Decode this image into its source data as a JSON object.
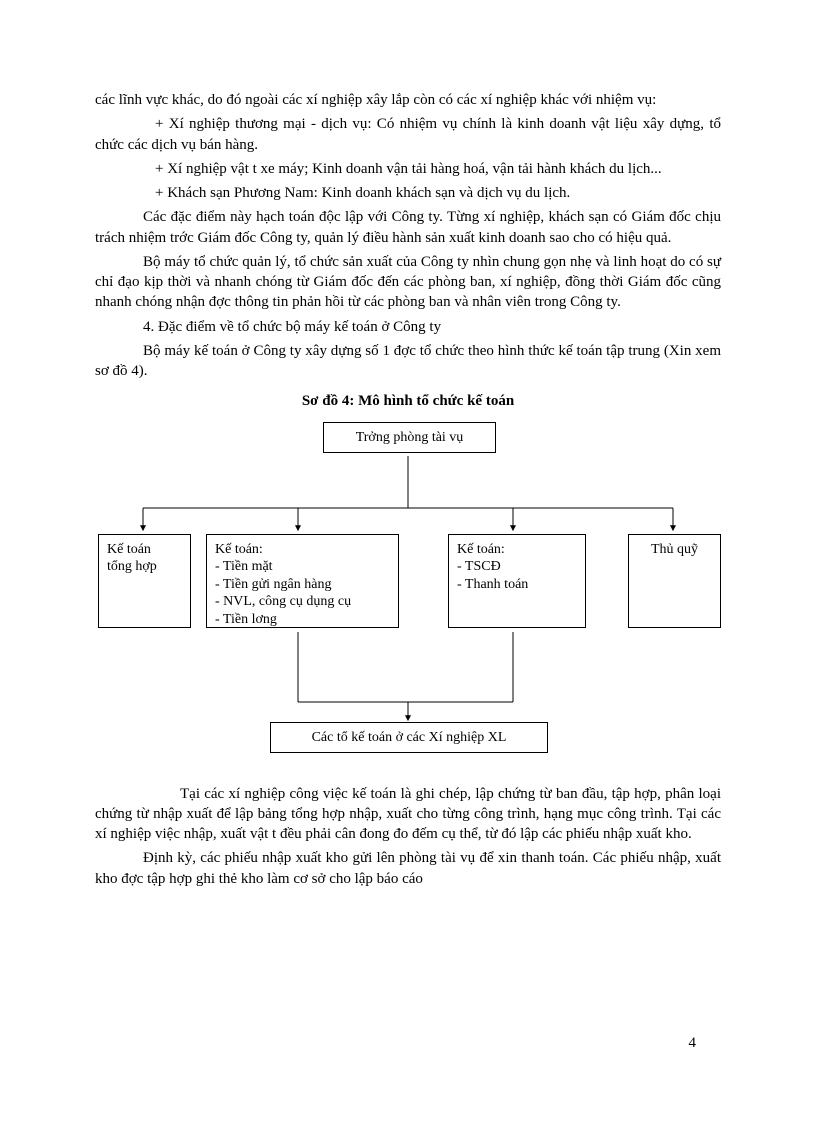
{
  "paragraphs": {
    "p1": "các lĩnh vực khác, do đó ngoài các xí nghiệp xây lắp còn có các xí nghiệp khác với nhiệm vụ:",
    "p2": "+ Xí nghiệp thương   mại - dịch vụ: Có nhiệm vụ chính là kinh doanh vật liệu xây dựng, tổ chức các dịch vụ bán hàng.",
    "p3": "+ Xí nghiệp vật t   xe máy; Kinh doanh vận tải hàng hoá, vận tải hành khách du lịch...",
    "p4": "+ Khách sạn Phương   Nam: Kinh doanh khách sạn và dịch vụ du lịch.",
    "p5": "Các đặc điểm này hạch toán độc lập với Công ty. Từng xí nghiệp, khách sạn có Giám đốc chịu trách nhiệm trớc   Giám đốc Công ty, quản lý điều hành sản xuất kinh doanh sao cho có hiệu quả.",
    "p6": "Bộ máy tổ chức quản lý, tổ chức sản xuất của Công ty nhìn chung gọn nhẹ và linh hoạt do có sự chỉ đạo kịp thời và nhanh chóng từ Giám đốc đến các phòng ban, xí nghiệp, đồng thời Giám đốc cũng nhanh chóng nhận đợc thông tin phản hồi từ các phòng ban và nhân viên trong Công ty.",
    "p7": "4. Đặc điểm về tổ chức bộ máy kế toán ở Công ty",
    "p8": "Bộ máy kế toán ở Công ty xây dựng số 1 đợc   tổ chức theo hình thức kế toán tập trung (Xin xem sơ đồ 4).",
    "diag_title": "Sơ đồ 4: Mô hình tổ chức kế toán",
    "p9": "Tại các xí nghiệp công việc kế toán là ghi chép, lập chứng từ ban đầu, tập hợp, phân loại chứng từ nhập xuất để lập bảng tổng hợp nhập, xuất cho từng công trình, hạng mục công trình. Tại các xí nghiệp việc nhập, xuất vật t  đều phải cân đong đo đếm cụ thể, từ đó lập các phiếu nhập xuất kho.",
    "p10": "Định kỳ, các phiếu nhập xuất kho gửi lên phòng tài vụ để xin thanh toán. Các phiếu nhập, xuất kho đợc   tập hợp ghi thẻ kho làm cơ sở cho lập báo cáo"
  },
  "diagram": {
    "top": "Trởng   phòng tài vụ",
    "box1_l1": "Kế toán",
    "box1_l2": "tổng hợp",
    "box2_l1": "Kế toán:",
    "box2_l2": "- Tiền mặt",
    "box2_l3": "- Tiền gửi ngân hàng",
    "box2_l4": "- NVL, công cụ dụng cụ",
    "box2_l5": "- Tiền lơng",
    "box3_l1": "Kế toán:",
    "box3_l2": "- TSCĐ",
    "box3_l3": "- Thanh toán",
    "box4_l1": "Thủ quỹ",
    "bottom": "Các tổ kế toán  ở các Xí nghiệp XL"
  },
  "page_number": "4"
}
